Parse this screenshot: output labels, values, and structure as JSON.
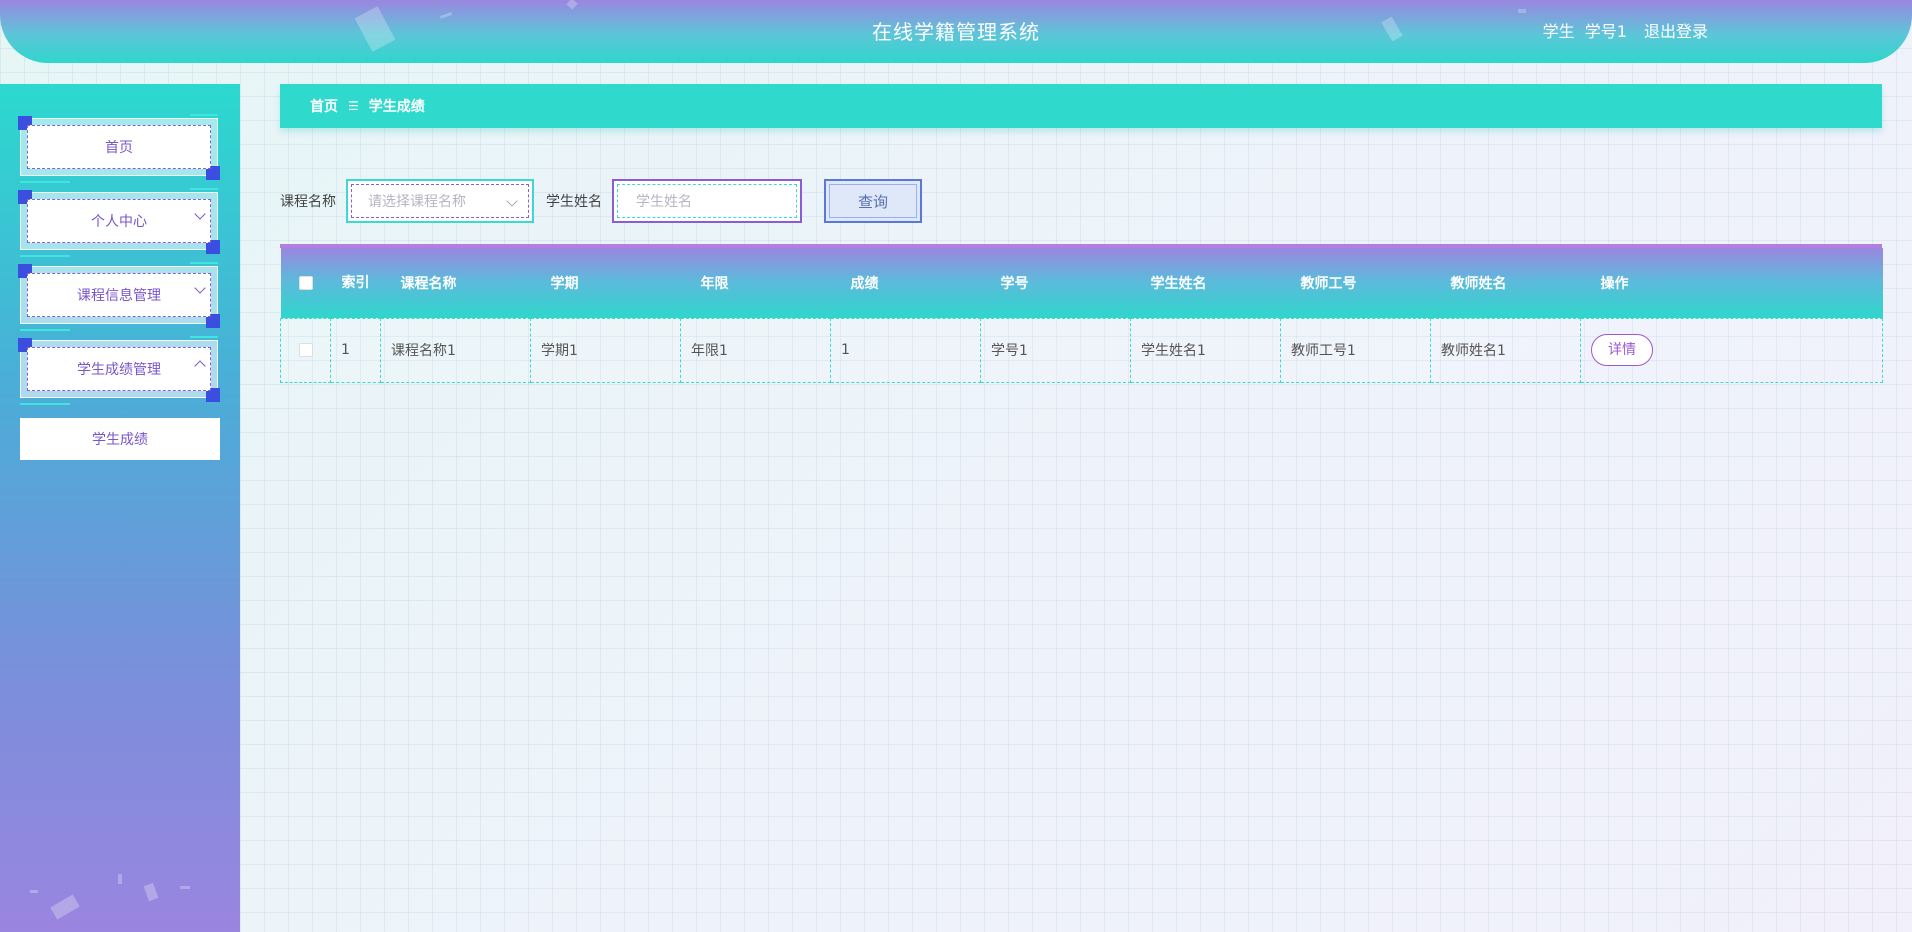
{
  "header": {
    "title": "在线学籍管理系统",
    "user_role": "学生",
    "user_name": "学号1",
    "logout_label": "退出登录"
  },
  "sidebar": {
    "items": [
      {
        "label": "首页",
        "chevron": "none"
      },
      {
        "label": "个人中心",
        "chevron": "chevron-down-icon"
      },
      {
        "label": "课程信息管理",
        "chevron": "chevron-down-icon"
      },
      {
        "label": "学生成绩管理",
        "chevron": "chevron-up-icon"
      }
    ],
    "submenu": [
      {
        "label": "学生成绩"
      }
    ]
  },
  "breadcrumb": {
    "home": "首页",
    "separator": "☰",
    "current": "学生成绩"
  },
  "search": {
    "course_label": "课程名称",
    "course_placeholder": "请选择课程名称",
    "student_label": "学生姓名",
    "student_placeholder": "学生姓名",
    "query_label": "查询"
  },
  "table": {
    "headers": {
      "index": "索引",
      "course_name": "课程名称",
      "term": "学期",
      "years": "年限",
      "score": "成绩",
      "student_no": "学号",
      "student_name": "学生姓名",
      "teacher_no": "教师工号",
      "teacher_name": "教师姓名",
      "action": "操作"
    },
    "rows": [
      {
        "index": "1",
        "course_name": "课程名称1",
        "term": "学期1",
        "years": "年限1",
        "score": "1",
        "student_no": "学号1",
        "student_name": "学生姓名1",
        "teacher_no": "教师工号1",
        "teacher_name": "教师姓名1",
        "action_label": "详情"
      }
    ]
  },
  "colors": {
    "accent_teal": "#2fdacc",
    "accent_purple": "#9b86e0",
    "menu_text": "#7a55c8",
    "detail_button": "#9b59d0"
  }
}
